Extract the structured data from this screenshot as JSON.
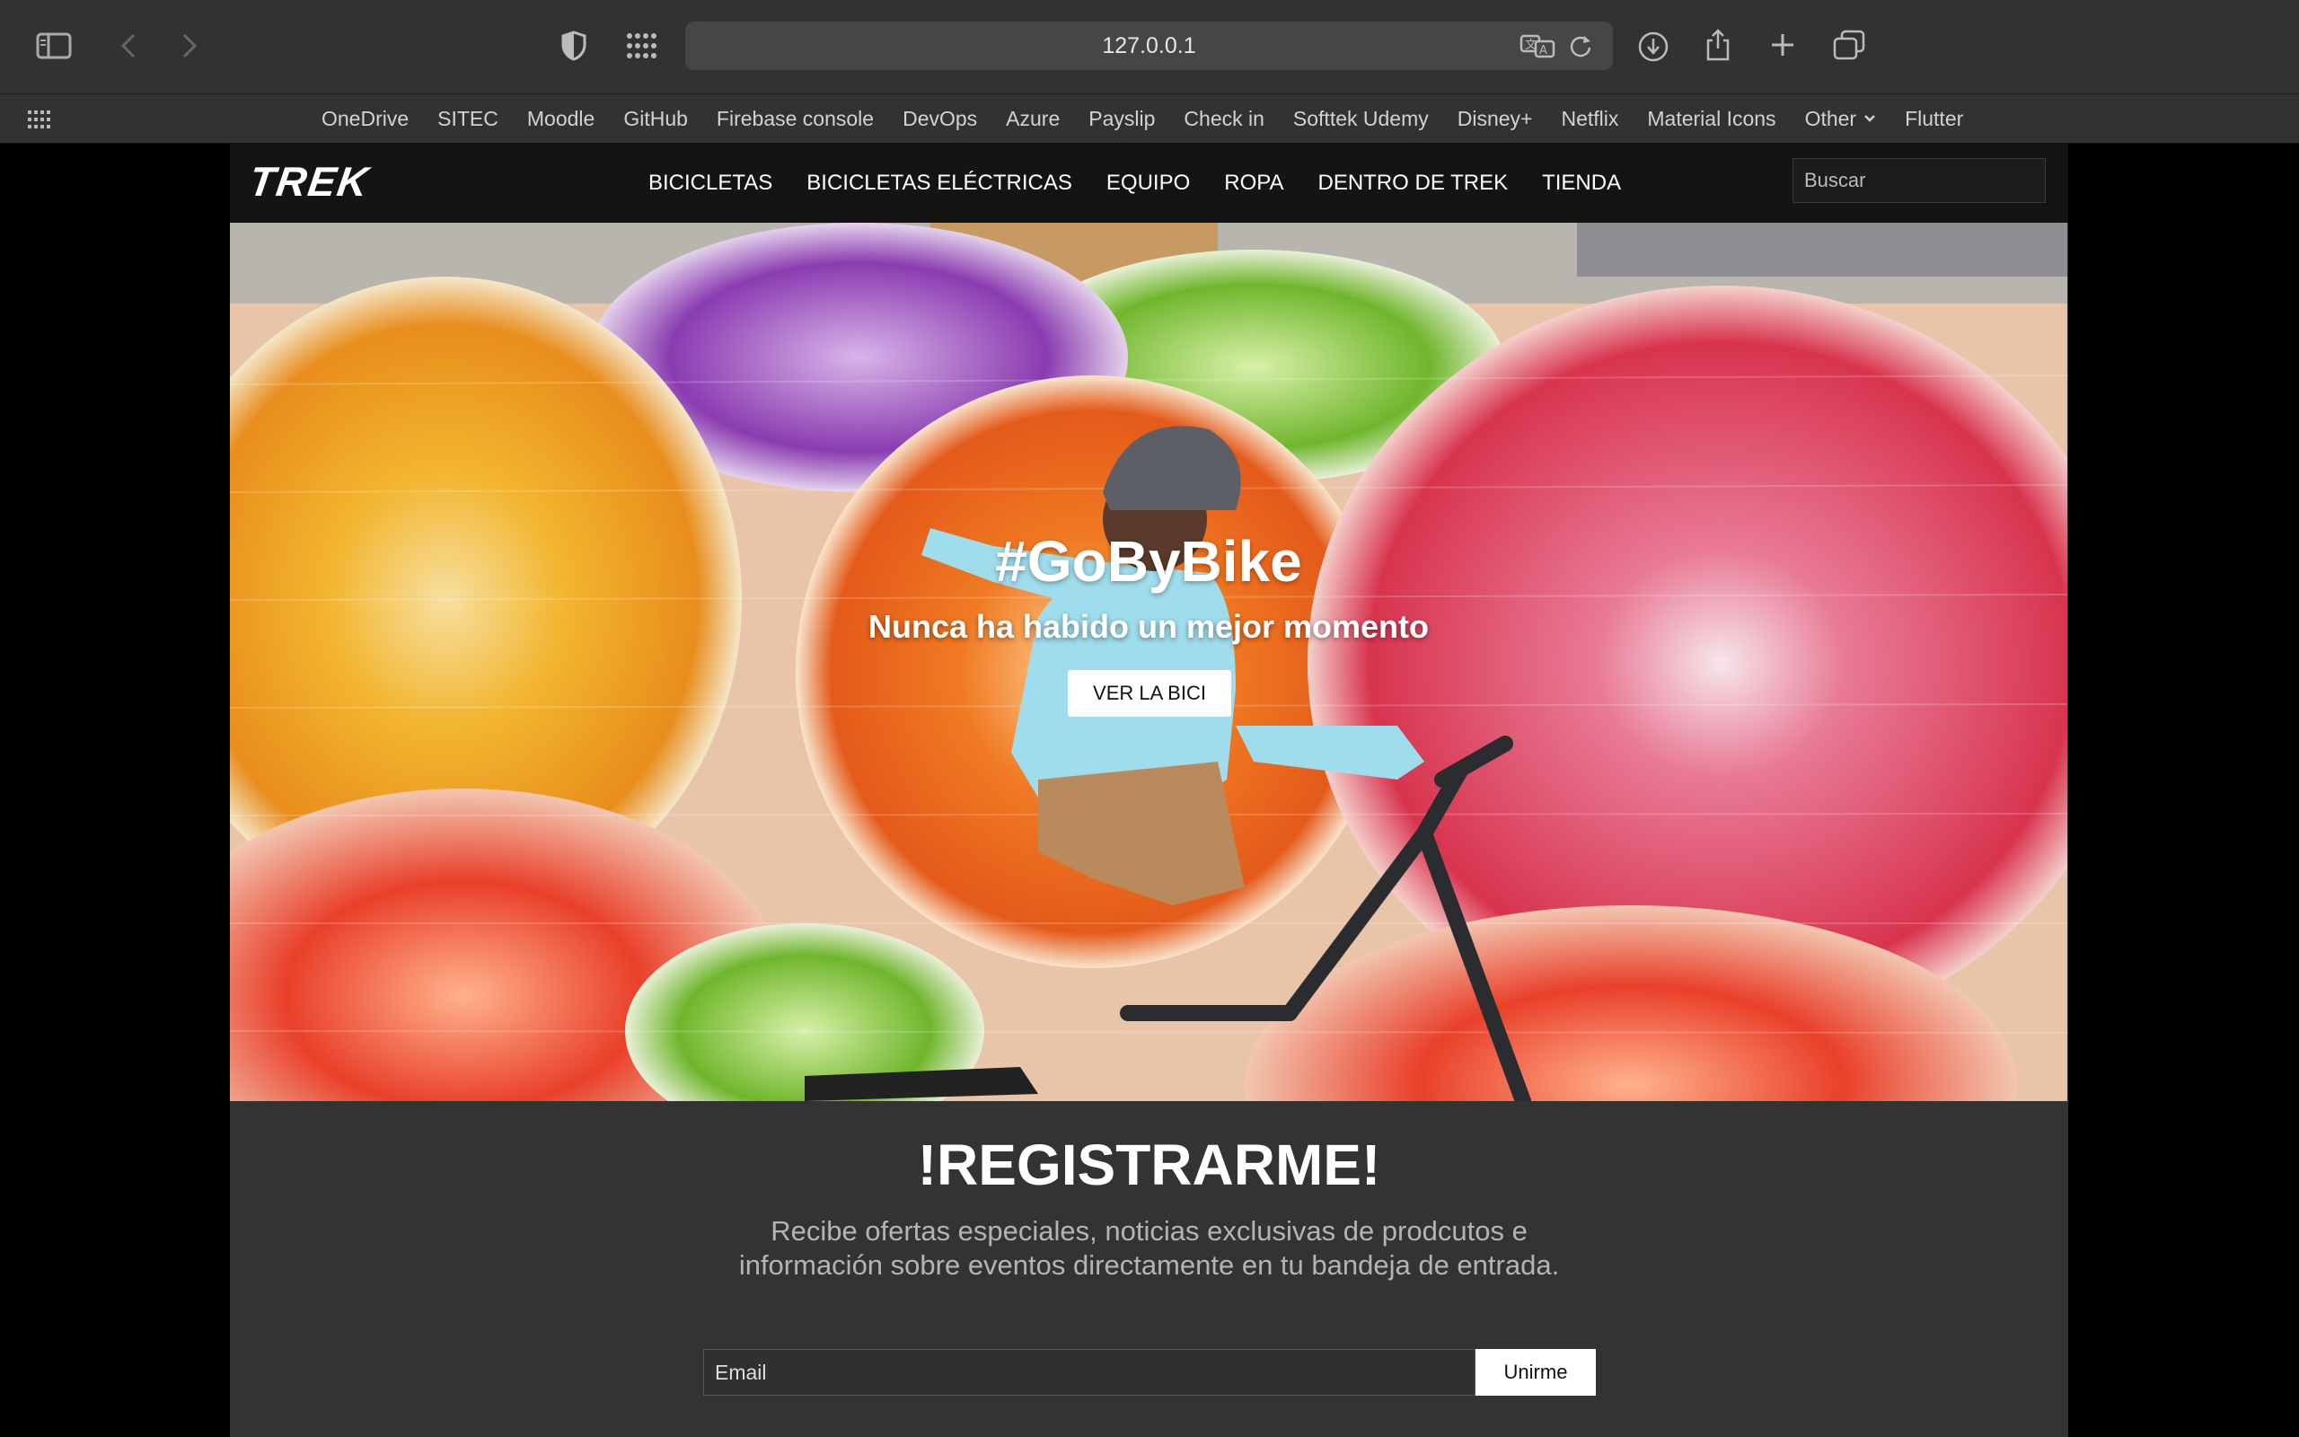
{
  "browser": {
    "url": "127.0.0.1",
    "bookmarks": [
      "OneDrive",
      "SITEC",
      "Moodle",
      "GitHub",
      "Firebase console",
      "DevOps",
      "Azure",
      "Payslip",
      "Check in",
      "Softtek Udemy",
      "Disney+",
      "Netflix",
      "Material Icons",
      "Other",
      "Flutter"
    ],
    "icons": [
      "sidebar-icon",
      "back-icon",
      "forward-icon",
      "shield-icon",
      "grid-icon",
      "translate-icon",
      "reload-icon",
      "download-icon",
      "share-icon",
      "new-tab-icon",
      "tabs-overview-icon"
    ]
  },
  "site": {
    "logo": "TREK",
    "menu": [
      "BICICLETAS",
      "BICICLETAS ELÉCTRICAS",
      "EQUIPO",
      "ROPA",
      "DENTRO DE TREK",
      "TIENDA"
    ],
    "search_placeholder": "Buscar"
  },
  "hero": {
    "title": "#GoByBike",
    "subtitle": "Nunca ha habido un mejor momento",
    "button": "VER LA BICI"
  },
  "register": {
    "title": "!REGISTRARME!",
    "desc_line1": "Recibe ofertas especiales, noticias exclusivas de prodcutos e",
    "desc_line2": "información sobre eventos directamente en tu bandeja de entrada.",
    "email_placeholder": "Email",
    "button": "Unirme"
  },
  "colors": {
    "chrome": "#323232",
    "page_bg": "#333333",
    "nav_bg": "#141414",
    "accent": "#ffffff"
  }
}
